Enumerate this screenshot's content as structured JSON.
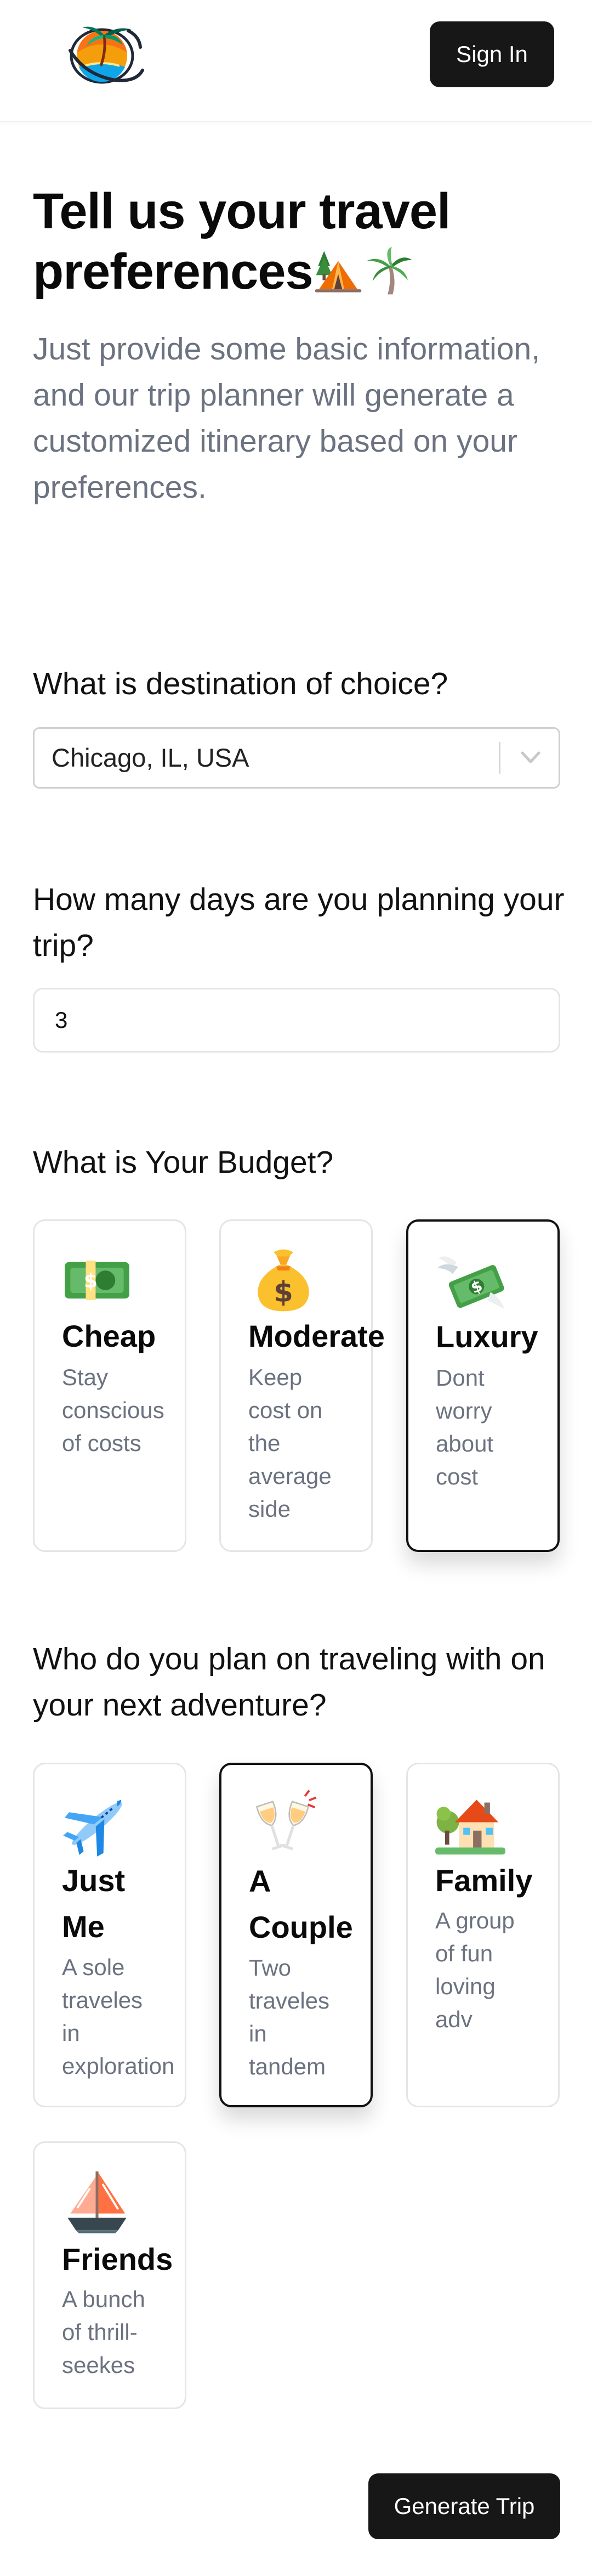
{
  "header": {
    "logo_icon": "tropical-island-globe-logo",
    "signin_label": "Sign In"
  },
  "hero": {
    "title": "Tell us your travel preferences",
    "title_icons": [
      "camping-tent-icon",
      "palm-tree-icon"
    ],
    "subtitle": "Just provide some basic information, and our trip planner will generate a customized itinerary based on your preferences."
  },
  "destination": {
    "question": "What is destination of choice?",
    "value": "Chicago, IL, USA"
  },
  "days": {
    "question": "How many days are you planning your trip?",
    "value": "3"
  },
  "budget": {
    "question": "What is Your Budget?",
    "options": [
      {
        "title": "Cheap",
        "desc": "Stay\nconscious\nof costs",
        "icon": "dollar-banknote-icon",
        "selected": false
      },
      {
        "title": "Moderate",
        "desc": "Keep\ncost on\nthe\naverage\nside",
        "icon": "money-bag-icon",
        "selected": false
      },
      {
        "title": "Luxury",
        "desc": "Dont\nworry\nabout\ncost",
        "icon": "money-with-wings-icon",
        "selected": true
      }
    ]
  },
  "travelers": {
    "question": "Who do you plan on traveling with on your next adventure?",
    "options": [
      {
        "title": "Just\nMe",
        "desc": "A sole\ntraveles\nin\nexploration",
        "icon": "airplane-icon",
        "selected": false
      },
      {
        "title": "A\nCouple",
        "desc": "Two\ntraveles\nin\ntandem",
        "icon": "clinking-glasses-icon",
        "selected": true
      },
      {
        "title": "Family",
        "desc": "A group\nof fun\nloving\nadv",
        "icon": "house-with-garden-icon",
        "selected": false
      },
      {
        "title": "Friends",
        "desc": "A bunch\nof thrill-\nseekes",
        "icon": "sailboat-icon",
        "selected": false
      }
    ]
  },
  "footer": {
    "generate_label": "Generate Trip"
  },
  "colors": {
    "primary_button": "#171717",
    "muted_text": "#6b7280",
    "card_border": "#e5e5e5",
    "selected_border": "#111111"
  }
}
